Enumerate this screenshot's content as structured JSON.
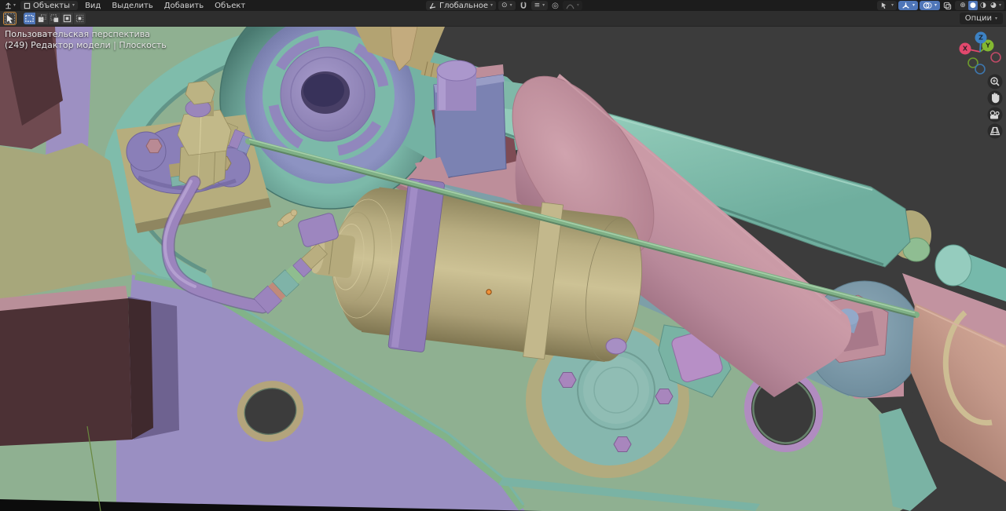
{
  "header": {
    "mode_label": "Объекты",
    "menus": [
      "Вид",
      "Выделить",
      "Добавить",
      "Объект"
    ],
    "orientation_label": "Глобальное",
    "options_label": "Опции"
  },
  "viewport": {
    "overlay_line1": "Пользовательская перспектива",
    "overlay_line2": "(249) Редактор модели | Плоскость",
    "gizmo_axes": {
      "x": "X",
      "y": "Y",
      "z": "Z"
    }
  },
  "colors": {
    "accent_blue": "#4f76b8",
    "header_bg": "#1c1c1c",
    "toolbar_bg": "#2e2e2e",
    "viewport_bg": "#3c3c3c",
    "axis_x": "#e2486d",
    "axis_y": "#76a82e",
    "axis_z": "#3d82c4",
    "cursor_orange": "#ef9038",
    "scene_palette": {
      "plate_green": "#8fb091",
      "rim_teal": "#7fbcab",
      "housing_teal": "#74b2a3",
      "bearing_ring_slate": "#8187b8",
      "bearing_disc_purple": "#968abd",
      "arm_pink": "#bd8e9a",
      "cylinder_pink": "#c18f9c",
      "tank_khaki": "#bcb183",
      "strap_purple": "#8f7cb7",
      "pipe_purple": "#9b84bd",
      "rod_green": "#7fb086",
      "beam_teal": "#85c2b0",
      "plate_blue": "#7d9fa8",
      "barrel_tan": "#c59a8b",
      "plate_olive": "#a7a77b",
      "underplate_purple": "#9a8fc2",
      "box_maroon": "#4c3135"
    }
  }
}
